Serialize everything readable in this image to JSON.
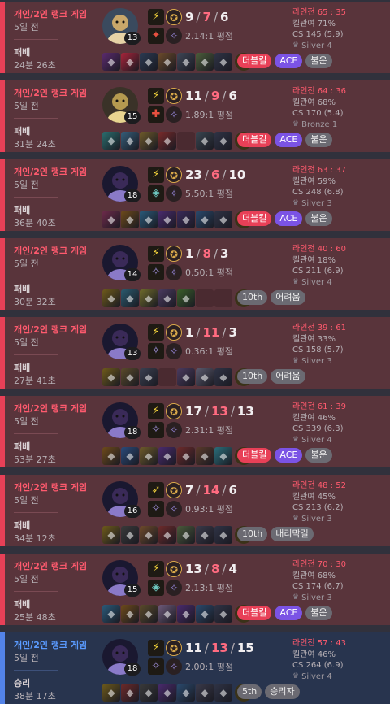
{
  "matches": [
    {
      "result": "loss",
      "queue": "개인/2인 랭크 게임",
      "ago": "5일 전",
      "outcome": "패배",
      "duration": "24분 26초",
      "level": "13",
      "champion_icon": "ezreal-portrait-icon",
      "spell1_icon": "flash-icon",
      "spell2_icon": "ignite-icon",
      "kills": "9",
      "deaths": "7",
      "assists": "6",
      "kda_ratio": "2.14:1 평점",
      "lane_label": "라인전 65 : 35",
      "kill_participation": "킬관여 71%",
      "cs": "CS 145 (5.9)",
      "tier": "Silver 4",
      "tier_icon": "silver-emblem-icon",
      "badges": [
        {
          "text": "더블킬",
          "type": "multi"
        },
        {
          "text": "ACE",
          "type": "ace"
        },
        {
          "text": "불운",
          "type": "tag"
        }
      ],
      "items": [
        "#5b2a6e",
        "#a8243a",
        "#2b3a52",
        "#6c4a2a",
        "#3e4656",
        "#4c5e3a",
        "#2f3345"
      ]
    },
    {
      "result": "loss",
      "queue": "개인/2인 랭크 게임",
      "ago": "5일 전",
      "outcome": "패배",
      "duration": "31분 24초",
      "level": "15",
      "champion_icon": "jhin-portrait-icon",
      "spell1_icon": "flash-icon",
      "spell2_icon": "heal-icon",
      "kills": "11",
      "deaths": "9",
      "assists": "6",
      "kda_ratio": "1.89:1 평점",
      "lane_label": "라인전 64 : 36",
      "kill_participation": "킬관여 68%",
      "cs": "CS 170 (5.4)",
      "tier": "Bronze 1",
      "tier_icon": "bronze-emblem-icon",
      "badges": [
        {
          "text": "더블킬",
          "type": "multi"
        },
        {
          "text": "ACE",
          "type": "ace"
        },
        {
          "text": "불운",
          "type": "tag"
        }
      ],
      "items": [
        "#2a6e6e",
        "#355e7a",
        "#6e5a2a",
        "#7a2a2a",
        "",
        "#3a4650",
        "#2f3345"
      ]
    },
    {
      "result": "loss",
      "queue": "개인/2인 랭크 게임",
      "ago": "5일 전",
      "outcome": "패배",
      "duration": "36분 40초",
      "level": "18",
      "champion_icon": "kaisa-portrait-icon",
      "spell1_icon": "flash-icon",
      "spell2_icon": "barrier-icon",
      "kills": "23",
      "deaths": "6",
      "assists": "10",
      "kda_ratio": "5.50:1 평점",
      "lane_label": "라인전 63 : 37",
      "kill_participation": "킬관여 59%",
      "cs": "CS 248 (6.8)",
      "tier": "Silver 3",
      "tier_icon": "silver-emblem-icon",
      "badges": [
        {
          "text": "더블킬",
          "type": "multi"
        },
        {
          "text": "ACE",
          "type": "ace"
        },
        {
          "text": "불운",
          "type": "tag"
        }
      ],
      "items": [
        "#6e2a4a",
        "#6e4a1a",
        "#2a5a7a",
        "#4a2a6e",
        "#3a2a5a",
        "#2a4a6e",
        "#2f3345"
      ]
    },
    {
      "result": "loss",
      "queue": "개인/2인 랭크 게임",
      "ago": "5일 전",
      "outcome": "패배",
      "duration": "30분 32초",
      "level": "14",
      "champion_icon": "kaisa-portrait-icon",
      "spell1_icon": "flash-icon",
      "spell2_icon": "cleanse-icon",
      "kills": "1",
      "deaths": "8",
      "assists": "3",
      "kda_ratio": "0.50:1 평점",
      "lane_label": "라인전 40 : 60",
      "kill_participation": "킬관여 18%",
      "cs": "CS 211 (6.9)",
      "tier": "Silver 4",
      "tier_icon": "silver-emblem-icon",
      "badges": [
        {
          "text": "10th",
          "type": "tag"
        },
        {
          "text": "어려움",
          "type": "tag"
        }
      ],
      "items": [
        "#6e5a1a",
        "#2a5a6e",
        "#6e6a2a",
        "#4a3a5e",
        "#3a5e2a",
        "",
        ""
      ]
    },
    {
      "result": "loss",
      "queue": "개인/2인 랭크 게임",
      "ago": "5일 전",
      "outcome": "패배",
      "duration": "27분 41초",
      "level": "13",
      "champion_icon": "kaisa-portrait-icon",
      "spell1_icon": "flash-icon",
      "spell2_icon": "cleanse-icon",
      "kills": "1",
      "deaths": "11",
      "assists": "3",
      "kda_ratio": "0.36:1 평점",
      "lane_label": "라인전 39 : 61",
      "kill_participation": "킬관여 33%",
      "cs": "CS 158 (5.7)",
      "tier": "Silver 3",
      "tier_icon": "silver-emblem-icon",
      "badges": [
        {
          "text": "10th",
          "type": "tag"
        },
        {
          "text": "어려움",
          "type": "tag"
        }
      ],
      "items": [
        "#6e5a1a",
        "#5a4a2a",
        "#3a4050",
        "",
        "#4a3a5e",
        "#5a5a6e",
        "#2f3345"
      ]
    },
    {
      "result": "loss",
      "queue": "개인/2인 랭크 게임",
      "ago": "5일 전",
      "outcome": "패배",
      "duration": "53분 27초",
      "level": "18",
      "champion_icon": "kaisa-portrait-icon",
      "spell1_icon": "flash-icon",
      "spell2_icon": "cleanse-icon",
      "kills": "17",
      "deaths": "13",
      "assists": "13",
      "kda_ratio": "2.31:1 평점",
      "lane_label": "라인전 61 : 39",
      "kill_participation": "킬관여 46%",
      "cs": "CS 339 (6.3)",
      "tier": "Silver 4",
      "tier_icon": "silver-emblem-icon",
      "badges": [
        {
          "text": "더블킬",
          "type": "multi"
        },
        {
          "text": "ACE",
          "type": "ace"
        },
        {
          "text": "불운",
          "type": "tag"
        }
      ],
      "items": [
        "#6e4a1a",
        "#2a4a7a",
        "#6e5a2a",
        "#4a2a6e",
        "#6e2a2a",
        "#5a3a2a",
        "#2a6e7a"
      ]
    },
    {
      "result": "loss",
      "queue": "개인/2인 랭크 게임",
      "ago": "5일 전",
      "outcome": "패배",
      "duration": "34분 12초",
      "level": "16",
      "champion_icon": "kaisa-portrait-icon",
      "spell1_icon": "ghost-icon",
      "spell2_icon": "cleanse-icon",
      "kills": "7",
      "deaths": "14",
      "assists": "6",
      "kda_ratio": "0.93:1 평점",
      "lane_label": "라인전 48 : 52",
      "kill_participation": "킬관여 45%",
      "cs": "CS 213 (6.2)",
      "tier": "Silver 3",
      "tier_icon": "silver-emblem-icon",
      "badges": [
        {
          "text": "10th",
          "type": "tag"
        },
        {
          "text": "내리막길",
          "type": "tag"
        }
      ],
      "items": [
        "#6e5a1a",
        "#3a3a3a",
        "#6e4a2a",
        "#6e2a2a",
        "#4a5a3a",
        "#3a3a4a",
        "#2f3345"
      ]
    },
    {
      "result": "loss",
      "queue": "개인/2인 랭크 게임",
      "ago": "5일 전",
      "outcome": "패배",
      "duration": "25분 48초",
      "level": "15",
      "champion_icon": "kaisa-portrait-icon",
      "spell1_icon": "flash-icon",
      "spell2_icon": "barrier-icon",
      "kills": "13",
      "deaths": "8",
      "assists": "4",
      "kda_ratio": "2.13:1 평점",
      "lane_label": "라인전 70 : 30",
      "kill_participation": "킬관여 68%",
      "cs": "CS 174 (6.7)",
      "tier": "Silver 3",
      "tier_icon": "silver-emblem-icon",
      "badges": [
        {
          "text": "더블킬",
          "type": "multi"
        },
        {
          "text": "ACE",
          "type": "ace"
        },
        {
          "text": "불운",
          "type": "tag"
        }
      ],
      "items": [
        "#2a5a7a",
        "#6e4a1a",
        "#5a4a2a",
        "#6e5a7a",
        "#4a2a6e",
        "#2a4a6e",
        "#2f3345"
      ]
    },
    {
      "result": "win",
      "queue": "개인/2인 랭크 게임",
      "ago": "5일 전",
      "outcome": "승리",
      "duration": "38분 17초",
      "level": "18",
      "champion_icon": "kaisa-portrait-icon",
      "spell1_icon": "flash-icon",
      "spell2_icon": "cleanse-icon",
      "kills": "11",
      "deaths": "13",
      "assists": "15",
      "kda_ratio": "2.00:1 평점",
      "lane_label": "라인전 57 : 43",
      "kill_participation": "킬관여 46%",
      "cs": "CS 264 (6.9)",
      "tier": "Silver 4",
      "tier_icon": "silver-emblem-icon",
      "badges": [
        {
          "text": "5th",
          "type": "tag"
        },
        {
          "text": "승리자",
          "type": "tag"
        }
      ],
      "items": [
        "#6e5a1a",
        "#6e2a2a",
        "#3a3a3a",
        "#4a2a6e",
        "#2a4a6e",
        "#3a3a4a",
        "#2f3345"
      ]
    }
  ]
}
